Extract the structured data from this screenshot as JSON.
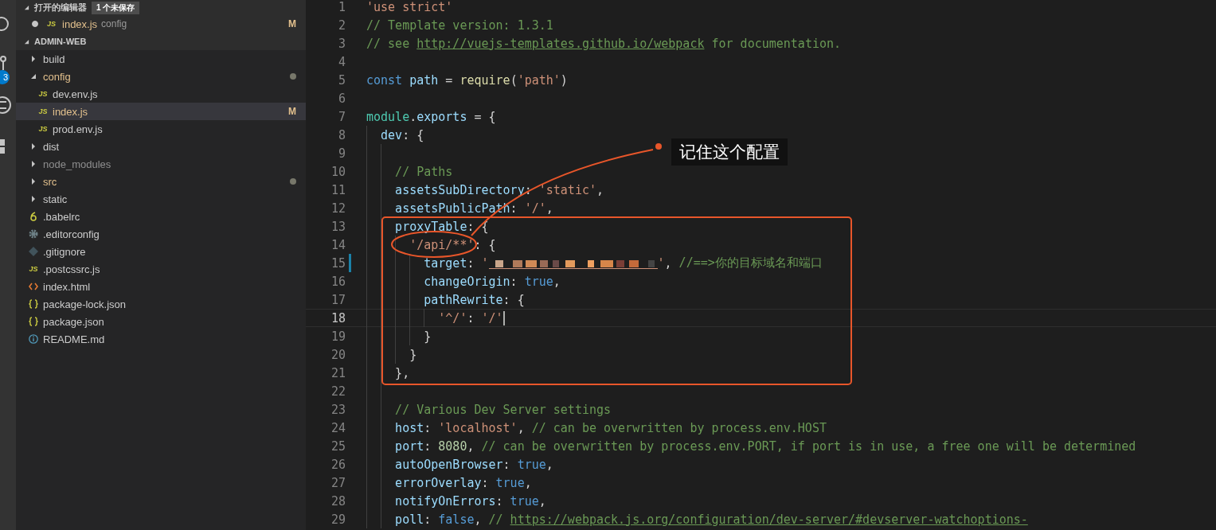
{
  "activity_bar": {
    "badge": "3"
  },
  "sidebar": {
    "open_editors": {
      "title": "打开的编辑器",
      "badge": "1 个未保存",
      "items": [
        {
          "name": "index.js",
          "kind": "js",
          "icon_label": "JS",
          "description": "config",
          "unsaved": true,
          "modified": true,
          "badge": "M"
        }
      ]
    },
    "project": {
      "title": "ADMIN-WEB",
      "expanded": true,
      "tree": [
        {
          "name": "build",
          "kind": "folder",
          "expanded": false,
          "modified": false,
          "ignored": false,
          "selected": false
        },
        {
          "name": "config",
          "kind": "folder",
          "expanded": true,
          "modified": true,
          "ignored": false,
          "dot": true,
          "selected": false,
          "children": [
            {
              "name": "dev.env.js",
              "kind": "js",
              "icon_label": "JS",
              "modified": false,
              "ignored": false,
              "selected": false
            },
            {
              "name": "index.js",
              "kind": "js",
              "icon_label": "JS",
              "modified": true,
              "ignored": false,
              "badge": "M",
              "selected": true
            },
            {
              "name": "prod.env.js",
              "kind": "js",
              "icon_label": "JS",
              "modified": false,
              "ignored": false,
              "selected": false
            }
          ]
        },
        {
          "name": "dist",
          "kind": "folder",
          "expanded": false,
          "modified": false,
          "ignored": false,
          "selected": false
        },
        {
          "name": "node_modules",
          "kind": "folder",
          "expanded": false,
          "modified": false,
          "ignored": true,
          "selected": false
        },
        {
          "name": "src",
          "kind": "folder",
          "expanded": false,
          "modified": true,
          "ignored": false,
          "dot": true,
          "selected": false
        },
        {
          "name": "static",
          "kind": "folder",
          "expanded": false,
          "modified": false,
          "ignored": false,
          "selected": false
        },
        {
          "name": ".babelrc",
          "kind": "babel",
          "modified": false,
          "ignored": false,
          "selected": false
        },
        {
          "name": ".editorconfig",
          "kind": "config",
          "modified": false,
          "ignored": false,
          "selected": false
        },
        {
          "name": ".gitignore",
          "kind": "git",
          "modified": false,
          "ignored": false,
          "selected": false
        },
        {
          "name": ".postcssrc.js",
          "kind": "js",
          "icon_label": "JS",
          "modified": false,
          "ignored": false,
          "selected": false
        },
        {
          "name": "index.html",
          "kind": "html",
          "modified": false,
          "ignored": false,
          "selected": false
        },
        {
          "name": "package-lock.json",
          "kind": "json",
          "modified": false,
          "ignored": false,
          "selected": false
        },
        {
          "name": "package.json",
          "kind": "json",
          "modified": false,
          "ignored": false,
          "selected": false
        },
        {
          "name": "README.md",
          "kind": "info",
          "modified": false,
          "ignored": false,
          "selected": false
        }
      ]
    }
  },
  "editor": {
    "lines": [
      {
        "number": "1",
        "tokens": [
          {
            "kind": "string",
            "text": "'use strict'"
          }
        ]
      },
      {
        "number": "2",
        "tokens": [
          {
            "kind": "comment",
            "text": "// Template version: 1.3.1"
          }
        ]
      },
      {
        "number": "3",
        "tokens": [
          {
            "kind": "comment",
            "text": "// see "
          },
          {
            "kind": "link",
            "text": "http://vuejs-templates.github.io/webpack"
          },
          {
            "kind": "comment",
            "text": " for documentation."
          }
        ]
      },
      {
        "number": "4"
      },
      {
        "number": "5",
        "tokens": [
          {
            "kind": "keyword",
            "text": "const"
          },
          {
            "kind": "variable",
            "text": " path"
          },
          {
            "kind": "plain",
            "text": " = "
          },
          {
            "kind": "function",
            "text": "require"
          },
          {
            "kind": "plain",
            "text": "("
          },
          {
            "kind": "string",
            "text": "'path'"
          },
          {
            "kind": "plain",
            "text": ")"
          }
        ]
      },
      {
        "number": "6"
      },
      {
        "number": "7",
        "tokens": [
          {
            "kind": "type",
            "text": "module"
          },
          {
            "kind": "plain",
            "text": "."
          },
          {
            "kind": "variable",
            "text": "exports"
          },
          {
            "kind": "plain",
            "text": " = {"
          }
        ],
        "children": [
          {
            "number": "8",
            "tokens": [
              {
                "kind": "variable",
                "text": "dev"
              },
              {
                "kind": "plain",
                "text": ": {"
              }
            ],
            "children": [
              {
                "number": "9"
              },
              {
                "number": "10",
                "tokens": [
                  {
                    "kind": "comment",
                    "text": "// Paths"
                  }
                ]
              },
              {
                "number": "11",
                "tokens": [
                  {
                    "kind": "variable",
                    "text": "assetsSubDirectory"
                  },
                  {
                    "kind": "plain",
                    "text": ": "
                  },
                  {
                    "kind": "string",
                    "text": "'static'"
                  },
                  {
                    "kind": "plain",
                    "text": ","
                  }
                ]
              },
              {
                "number": "12",
                "tokens": [
                  {
                    "kind": "variable",
                    "text": "assetsPublicPath"
                  },
                  {
                    "kind": "plain",
                    "text": ": "
                  },
                  {
                    "kind": "string",
                    "text": "'/'"
                  },
                  {
                    "kind": "plain",
                    "text": ","
                  }
                ]
              },
              {
                "number": "13",
                "tokens": [
                  {
                    "kind": "variable",
                    "text": "proxyTable"
                  },
                  {
                    "kind": "plain",
                    "text": ": {"
                  }
                ],
                "children": [
                  {
                    "number": "14",
                    "tokens": [
                      {
                        "kind": "string",
                        "text": "'/api/**'"
                      },
                      {
                        "kind": "plain",
                        "text": ": {"
                      }
                    ],
                    "children": [
                      {
                        "number": "15",
                        "changed": true,
                        "tokens": [
                          {
                            "kind": "variable",
                            "text": "target"
                          },
                          {
                            "kind": "plain",
                            "text": ": "
                          },
                          {
                            "kind": "string",
                            "text": "'"
                          },
                          {
                            "kind": "redacted"
                          },
                          {
                            "kind": "string",
                            "text": "'"
                          },
                          {
                            "kind": "plain",
                            "text": ", "
                          },
                          {
                            "kind": "comment",
                            "text": "//==>你的目标域名和端口"
                          }
                        ]
                      },
                      {
                        "number": "16",
                        "tokens": [
                          {
                            "kind": "variable",
                            "text": "changeOrigin"
                          },
                          {
                            "kind": "plain",
                            "text": ": "
                          },
                          {
                            "kind": "keyword",
                            "text": "true"
                          },
                          {
                            "kind": "plain",
                            "text": ","
                          }
                        ]
                      },
                      {
                        "number": "17",
                        "tokens": [
                          {
                            "kind": "variable",
                            "text": "pathRewrite"
                          },
                          {
                            "kind": "plain",
                            "text": ": {"
                          }
                        ],
                        "children": [
                          {
                            "number": "18",
                            "current": true,
                            "tokens": [
                              {
                                "kind": "string",
                                "text": "'^/'"
                              },
                              {
                                "kind": "plain",
                                "text": ": "
                              },
                              {
                                "kind": "string",
                                "text": "'/'"
                              }
                            ]
                          }
                        ]
                      },
                      {
                        "number": "19",
                        "tokens": [
                          {
                            "kind": "plain",
                            "text": "}"
                          }
                        ]
                      }
                    ]
                  },
                  {
                    "number": "20",
                    "tokens": [
                      {
                        "kind": "plain",
                        "text": "}"
                      }
                    ]
                  }
                ]
              },
              {
                "number": "21",
                "tokens": [
                  {
                    "kind": "plain",
                    "text": "},"
                  }
                ]
              },
              {
                "number": "22"
              },
              {
                "number": "23",
                "tokens": [
                  {
                    "kind": "comment",
                    "text": "// Various Dev Server settings"
                  }
                ]
              },
              {
                "number": "24",
                "tokens": [
                  {
                    "kind": "variable",
                    "text": "host"
                  },
                  {
                    "kind": "plain",
                    "text": ": "
                  },
                  {
                    "kind": "string",
                    "text": "'localhost'"
                  },
                  {
                    "kind": "plain",
                    "text": ", "
                  },
                  {
                    "kind": "comment",
                    "text": "// can be overwritten by process.env.HOST"
                  }
                ]
              },
              {
                "number": "25",
                "tokens": [
                  {
                    "kind": "variable",
                    "text": "port"
                  },
                  {
                    "kind": "plain",
                    "text": ": "
                  },
                  {
                    "kind": "number",
                    "text": "8080"
                  },
                  {
                    "kind": "plain",
                    "text": ", "
                  },
                  {
                    "kind": "comment",
                    "text": "// can be overwritten by process.env.PORT, if port is in use, a free one will be determined"
                  }
                ]
              },
              {
                "number": "26",
                "tokens": [
                  {
                    "kind": "variable",
                    "text": "autoOpenBrowser"
                  },
                  {
                    "kind": "plain",
                    "text": ": "
                  },
                  {
                    "kind": "keyword",
                    "text": "true"
                  },
                  {
                    "kind": "plain",
                    "text": ","
                  }
                ]
              },
              {
                "number": "27",
                "tokens": [
                  {
                    "kind": "variable",
                    "text": "errorOverlay"
                  },
                  {
                    "kind": "plain",
                    "text": ": "
                  },
                  {
                    "kind": "keyword",
                    "text": "true"
                  },
                  {
                    "kind": "plain",
                    "text": ","
                  }
                ]
              },
              {
                "number": "28",
                "tokens": [
                  {
                    "kind": "variable",
                    "text": "notifyOnErrors"
                  },
                  {
                    "kind": "plain",
                    "text": ": "
                  },
                  {
                    "kind": "keyword",
                    "text": "true"
                  },
                  {
                    "kind": "plain",
                    "text": ","
                  }
                ]
              },
              {
                "number": "29",
                "tokens": [
                  {
                    "kind": "variable",
                    "text": "poll"
                  },
                  {
                    "kind": "plain",
                    "text": ": "
                  },
                  {
                    "kind": "keyword",
                    "text": "false"
                  },
                  {
                    "kind": "plain",
                    "text": ", "
                  },
                  {
                    "kind": "comment",
                    "text": "// "
                  },
                  {
                    "kind": "link",
                    "text": "https://webpack.js.org/configuration/dev-server/#devserver-watchoptions-"
                  }
                ]
              }
            ]
          }
        ]
      }
    ]
  },
  "annotation": {
    "callout": "记住这个配置"
  }
}
